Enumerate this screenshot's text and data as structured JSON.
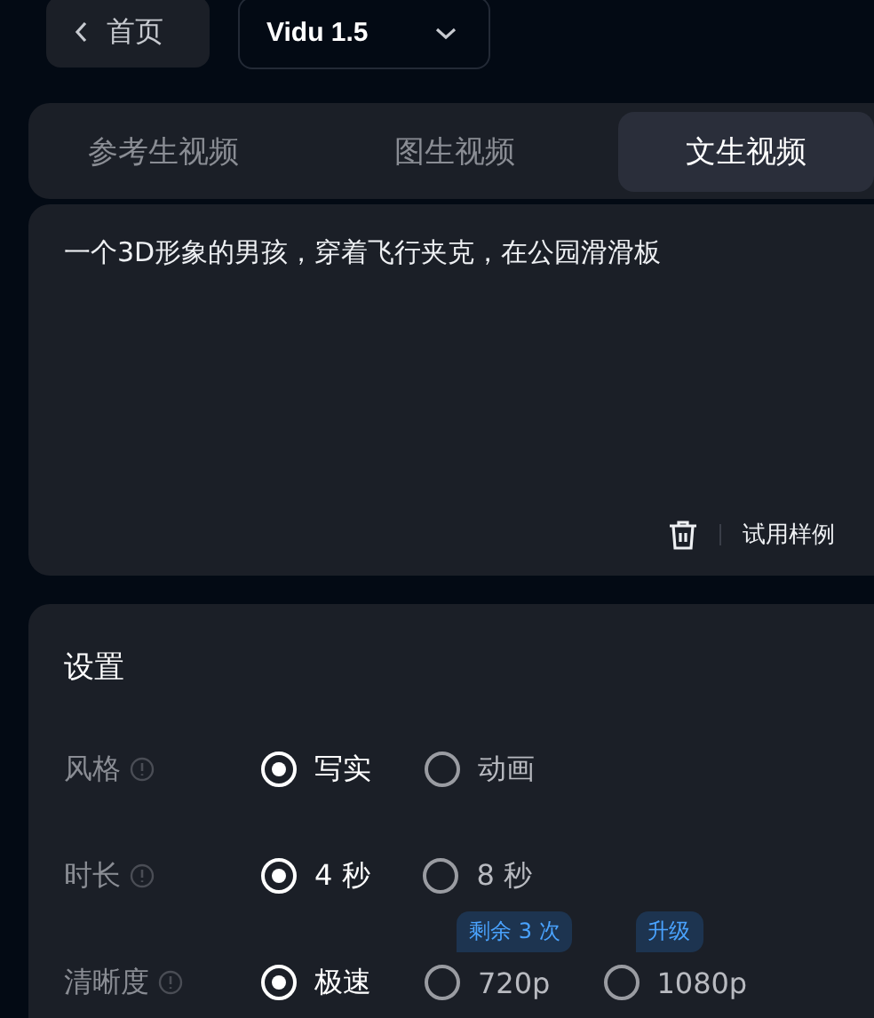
{
  "back_button": {
    "label": "首页"
  },
  "model_select": {
    "value": "Vidu 1.5"
  },
  "tabs": [
    {
      "label": "参考生视频",
      "selected": false
    },
    {
      "label": "图生视频",
      "selected": false
    },
    {
      "label": "文生视频",
      "selected": true
    }
  ],
  "prompt": {
    "value": "一个3D形象的男孩，穿着飞行夹克，在公园滑滑板",
    "sample_button": "试用样例"
  },
  "settings": {
    "title": "设置",
    "rows": [
      {
        "label": "风格",
        "options": [
          {
            "label": "写实",
            "selected": true
          },
          {
            "label": "动画",
            "selected": false
          }
        ]
      },
      {
        "label": "时长",
        "options": [
          {
            "label": "4 秒",
            "selected": true
          },
          {
            "label": "8 秒",
            "selected": false
          }
        ]
      },
      {
        "label": "清晰度",
        "options": [
          {
            "label": "极速",
            "selected": true
          },
          {
            "label": "720p",
            "selected": false,
            "badge": "剩余 3 次"
          },
          {
            "label": "1080p",
            "selected": false,
            "badge": "升级"
          }
        ]
      }
    ]
  }
}
